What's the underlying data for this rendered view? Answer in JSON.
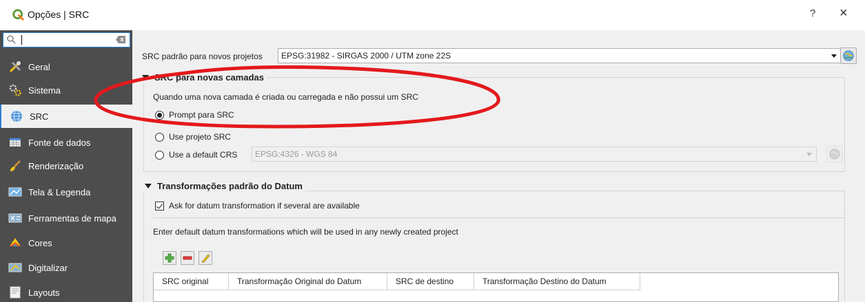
{
  "window": {
    "title": "Opções | SRC",
    "help": "?",
    "close": "×"
  },
  "sidebar": {
    "search_value": "",
    "items": [
      {
        "label": "Geral",
        "icon": "tools-icon"
      },
      {
        "label": "Sistema",
        "icon": "gears-icon"
      },
      {
        "label": "SRC",
        "icon": "globe-icon"
      },
      {
        "label": "Fonte de dados",
        "icon": "table-icon"
      },
      {
        "label": "Renderização",
        "icon": "brush-icon"
      },
      {
        "label": "Tela & Legenda",
        "icon": "map-canvas-icon"
      },
      {
        "label": "Ferramentas de mapa",
        "icon": "map-tools-icon"
      },
      {
        "label": "Cores",
        "icon": "colors-icon"
      },
      {
        "label": "Digitalizar",
        "icon": "digitize-icon"
      },
      {
        "label": "Layouts",
        "icon": "layout-icon"
      }
    ],
    "active_index": 2
  },
  "default_crs": {
    "label": "SRC padrão para novos projetos",
    "value": "EPSG:31982 - SIRGAS 2000 / UTM zone 22S"
  },
  "new_layers_group": {
    "title": "SRC para novas camadas",
    "description": "Quando uma nova camada é criada ou carregada e não possui um SRC",
    "options": [
      {
        "label": "Prompt para SRC",
        "checked": true
      },
      {
        "label": "Use projeto SRC",
        "checked": false
      },
      {
        "label": "Use a default CRS",
        "checked": false
      }
    ],
    "default_crs_value": "EPSG:4326 - WGS 84"
  },
  "datum_group": {
    "title": "Transformações padrão do Datum",
    "ask_checkbox_label": "Ask for datum transformation if several are available",
    "ask_checked": true,
    "description": "Enter default datum transformations which will be used in any newly created project",
    "table_headers": [
      "SRC original",
      "Transformação Original do Datum",
      "SRC de destino",
      "Transformação Destino do Datum"
    ]
  },
  "colors": {
    "sidebar_bg": "#4d4d4d",
    "accent": "#2d7fce",
    "annotation": "#e3191c"
  }
}
